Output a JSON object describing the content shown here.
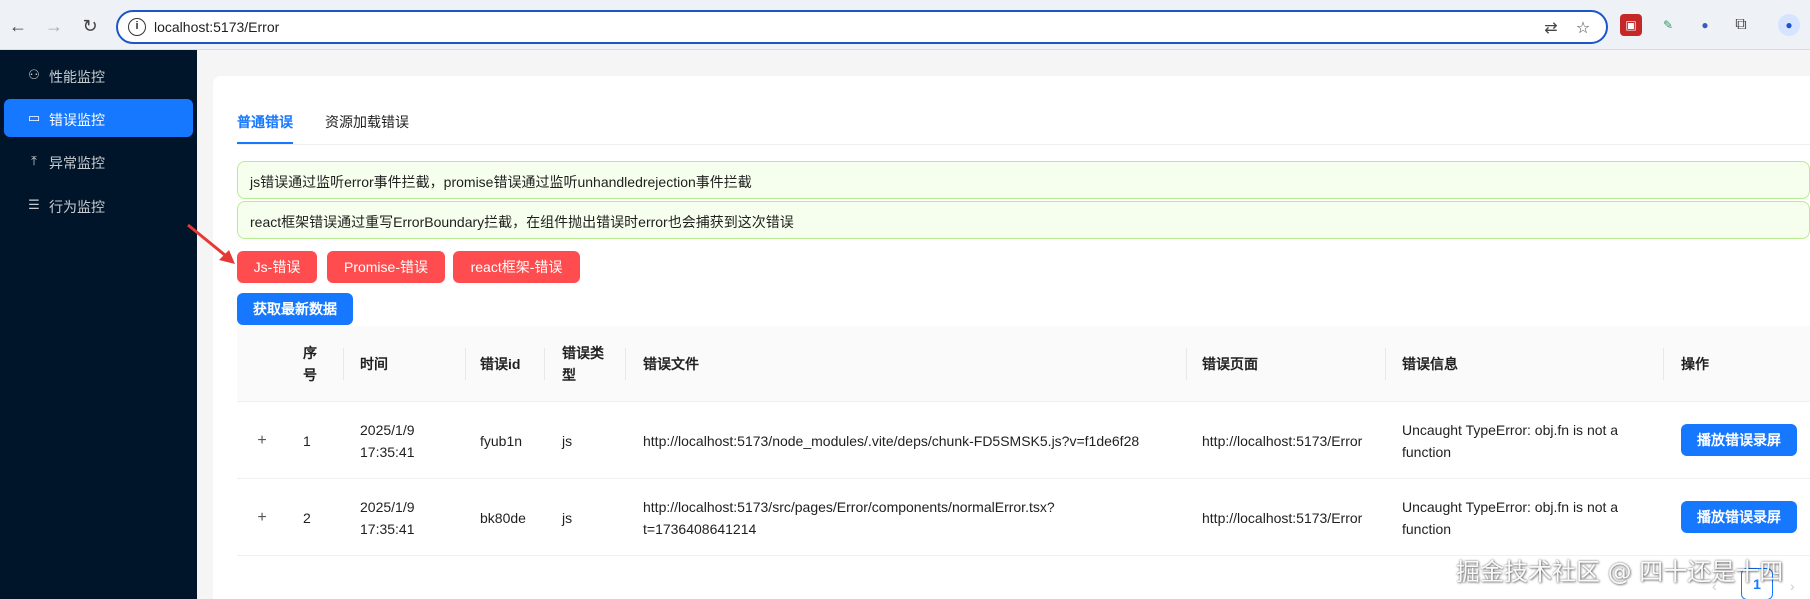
{
  "browser": {
    "url": "localhost:5173/Error"
  },
  "sidebar": {
    "items": [
      {
        "label": "性能监控",
        "icon": "user-icon"
      },
      {
        "label": "错误监控",
        "icon": "video-icon"
      },
      {
        "label": "异常监控",
        "icon": "upload-icon"
      },
      {
        "label": "行为监控",
        "icon": "list-icon"
      }
    ]
  },
  "tabs": [
    {
      "label": "普通错误"
    },
    {
      "label": "资源加载错误"
    }
  ],
  "alerts": [
    "js错误通过监听error事件拦截，promise错误通过监听unhandledrejection事件拦截",
    "react框架错误通过重写ErrorBoundary拦截，在组件抛出错误时error也会捕获到这次错误"
  ],
  "buttons": {
    "js_error": "Js-错误",
    "promise_error": "Promise-错误",
    "react_error": "react框架-错误",
    "fetch": "获取最新数据"
  },
  "table": {
    "columns": [
      "序号",
      "时间",
      "错误id",
      "错误类型",
      "错误文件",
      "错误页面",
      "错误信息",
      "操作"
    ],
    "rows": [
      {
        "index": "1",
        "time_date": "2025/1/9",
        "time_clock": "17:35:41",
        "id": "fyub1n",
        "type": "js",
        "file_line1": "http://localhost:5173/node_modules/.vite/deps/chunk-FD5SMSK5.js?v=f1de6f28",
        "file_line2": "",
        "page": "http://localhost:5173/Error",
        "msg_line1": "Uncaught TypeError: obj.fn is not a",
        "msg_line2": "function",
        "action": "播放错误录屏"
      },
      {
        "index": "2",
        "time_date": "2025/1/9",
        "time_clock": "17:35:41",
        "id": "bk80de",
        "type": "js",
        "file_line1": "http://localhost:5173/src/pages/Error/components/normalError.tsx?",
        "file_line2": "t=1736408641214",
        "page": "http://localhost:5173/Error",
        "msg_line1": "Uncaught TypeError: obj.fn is not a",
        "msg_line2": "function",
        "action": "播放错误录屏"
      }
    ]
  },
  "pagination": {
    "current": "1"
  },
  "watermark": "掘金技术社区 @ 四十还是十四"
}
